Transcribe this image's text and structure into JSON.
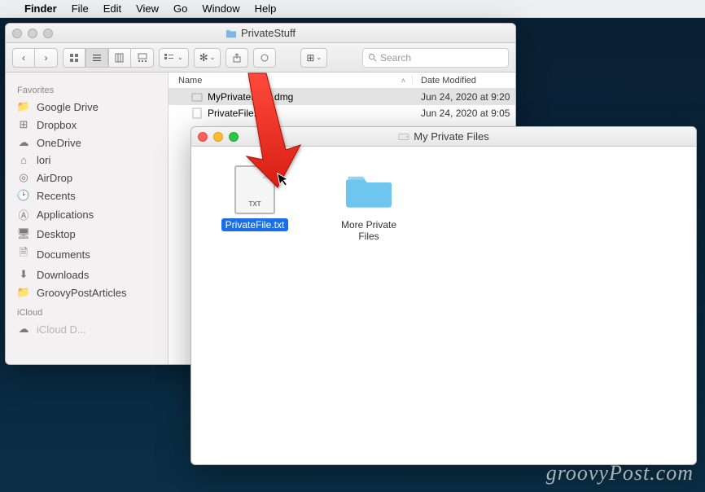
{
  "menubar": {
    "app": "Finder",
    "items": [
      "File",
      "Edit",
      "View",
      "Go",
      "Window",
      "Help"
    ]
  },
  "win1": {
    "title": "PrivateStuff",
    "search_placeholder": "Search",
    "sidebar": {
      "favorites_label": "Favorites",
      "icloud_label": "iCloud",
      "items": [
        {
          "icon": "folder",
          "label": "Google Drive"
        },
        {
          "icon": "dropbox",
          "label": "Dropbox"
        },
        {
          "icon": "cloud",
          "label": "OneDrive"
        },
        {
          "icon": "home",
          "label": "lori"
        },
        {
          "icon": "airdrop",
          "label": "AirDrop"
        },
        {
          "icon": "clock",
          "label": "Recents"
        },
        {
          "icon": "apps",
          "label": "Applications"
        },
        {
          "icon": "desktop",
          "label": "Desktop"
        },
        {
          "icon": "docs",
          "label": "Documents"
        },
        {
          "icon": "downloads",
          "label": "Downloads"
        },
        {
          "icon": "folder",
          "label": "GroovyPostArticles"
        }
      ]
    },
    "columns": {
      "name": "Name",
      "date": "Date Modified"
    },
    "rows": [
      {
        "icon": "dmg",
        "name": "MyPrivateFiles.dmg",
        "date": "Jun 24, 2020 at 9:20",
        "selected": true
      },
      {
        "icon": "txt",
        "name": "PrivateFile.txt",
        "date": "Jun 24, 2020 at 9:05",
        "selected": false
      }
    ]
  },
  "win2": {
    "title": "My Private Files",
    "items": [
      {
        "type": "txt",
        "label": "PrivateFile.txt",
        "selected": true
      },
      {
        "type": "folder",
        "label": "More Private Files",
        "selected": false
      }
    ]
  },
  "watermark": "groovyPost.com"
}
